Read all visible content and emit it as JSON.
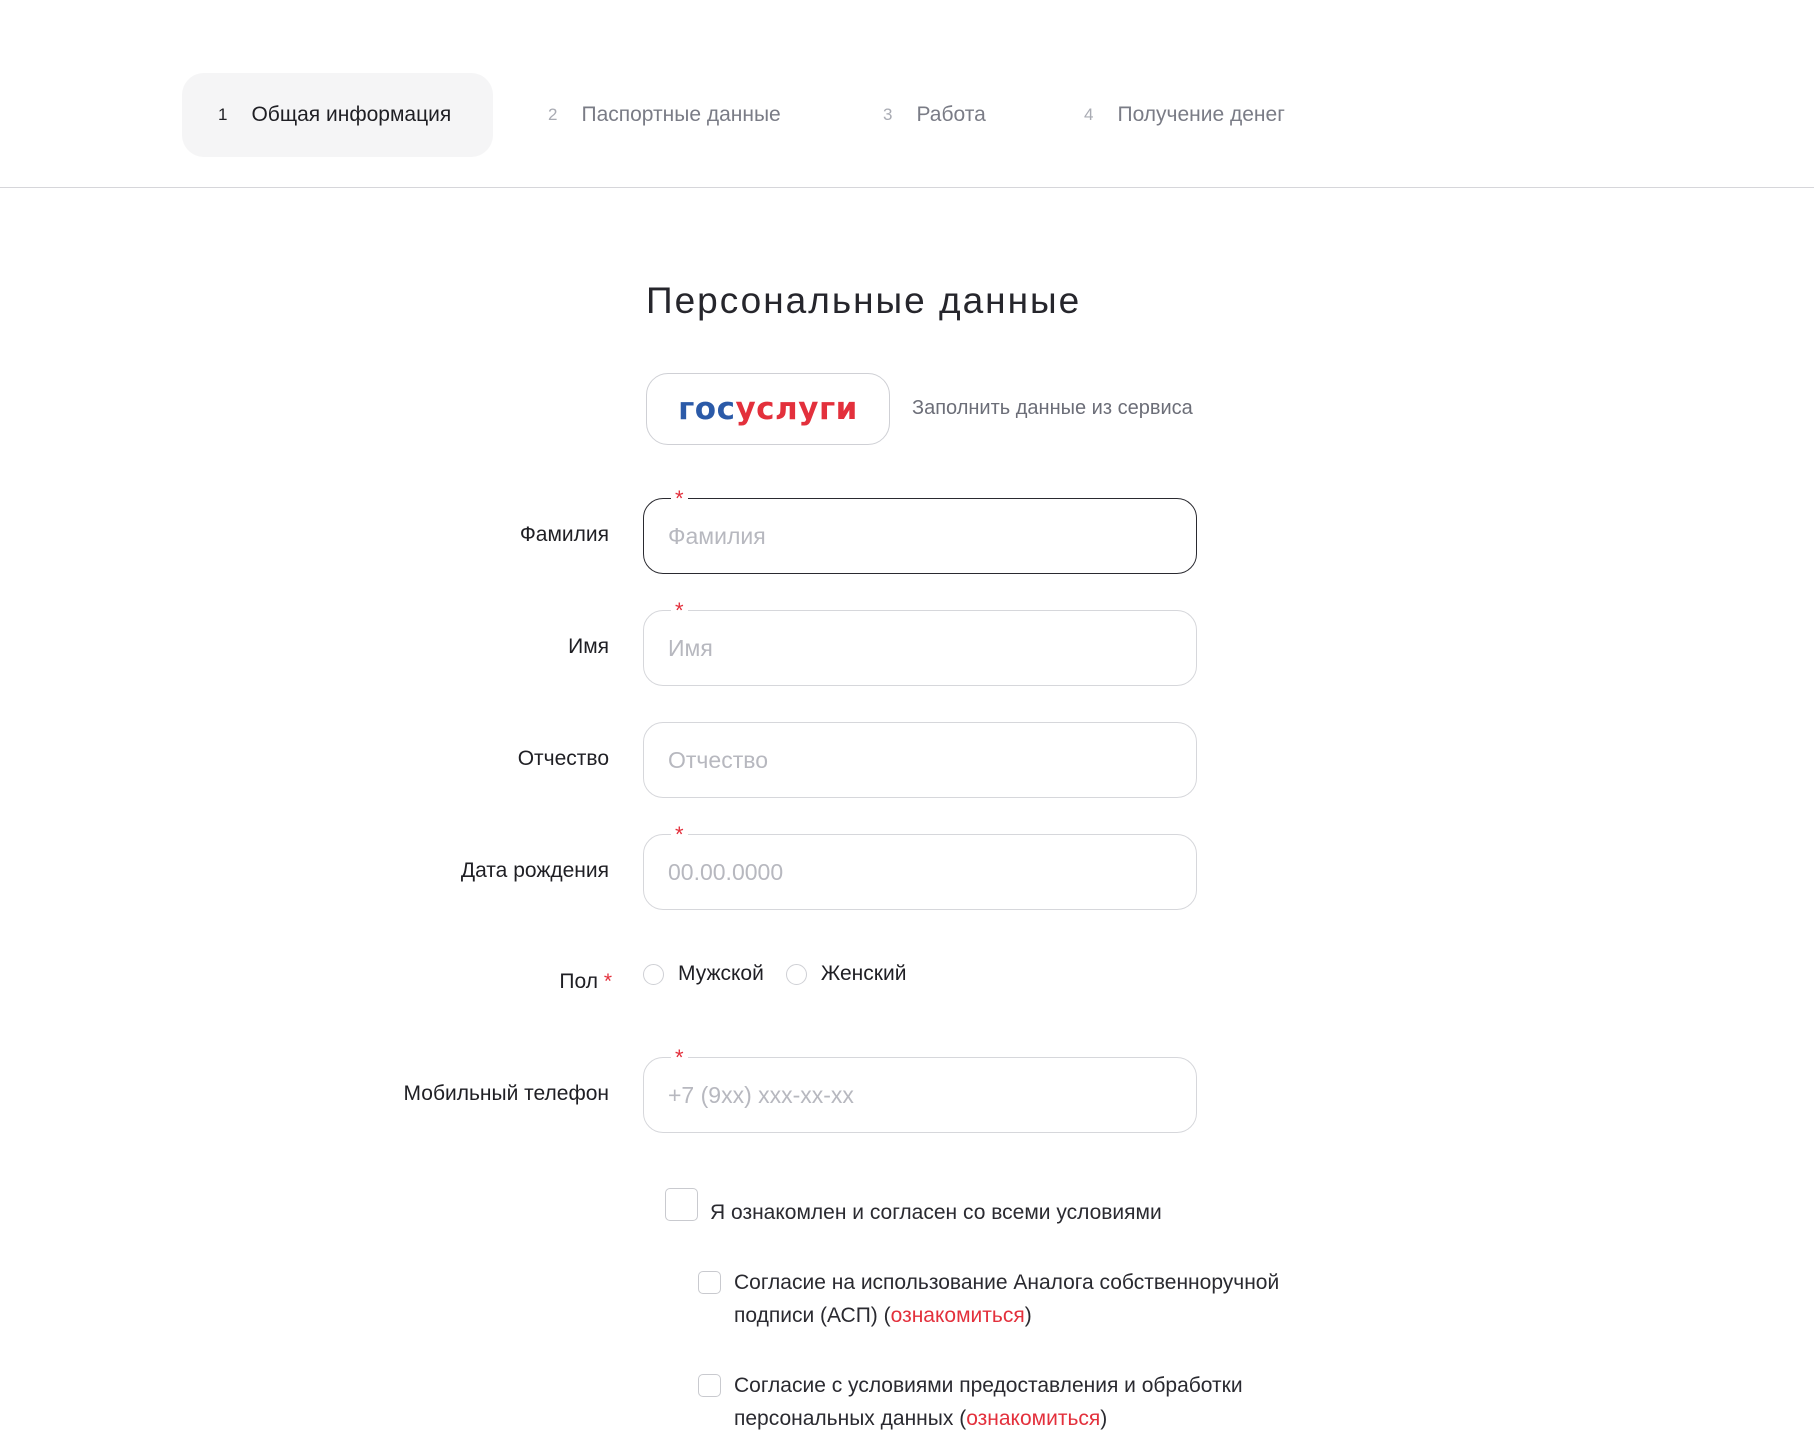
{
  "stepper": {
    "steps": [
      {
        "num": "1",
        "label": "Общая информация",
        "active": true
      },
      {
        "num": "2",
        "label": "Паспортные данные",
        "active": false
      },
      {
        "num": "3",
        "label": "Работа",
        "active": false
      },
      {
        "num": "4",
        "label": "Получение денег",
        "active": false
      }
    ]
  },
  "form": {
    "title": "Персональные данные",
    "gosuslugi": {
      "logo_part1": "гос",
      "logo_part2": "услуги",
      "hint": "Заполнить данные из сервиса"
    },
    "required_mark": "*",
    "fields": {
      "last_name": {
        "label": "Фамилия",
        "placeholder": "Фамилия",
        "value": ""
      },
      "first_name": {
        "label": "Имя",
        "placeholder": "Имя",
        "value": ""
      },
      "patronymic": {
        "label": "Отчество",
        "placeholder": "Отчество",
        "value": ""
      },
      "birth_date": {
        "label": "Дата рождения",
        "placeholder": "00.00.0000",
        "value": ""
      },
      "phone": {
        "label": "Мобильный телефон",
        "placeholder": "+7 (9xx) xxx-xx-xx",
        "value": ""
      }
    },
    "gender": {
      "label": "Пол",
      "options": [
        "Мужской",
        "Женский"
      ]
    },
    "agreements": {
      "all": "Я ознакомлен и согласен со всеми условиями",
      "asp_line1": "Согласие на использование Аналога собственноручной",
      "asp_line2_prefix": "подписи (АСП) (",
      "asp_link": "ознакомиться",
      "asp_suffix": ")",
      "pd_line1": "Согласие с условиями предоставления и обработки",
      "pd_line2_prefix": "персональных данных (",
      "pd_link": "ознакомиться",
      "pd_suffix": ")"
    }
  },
  "colors": {
    "accent_red": "#e3303c",
    "gos_blue": "#2b5aa8"
  }
}
